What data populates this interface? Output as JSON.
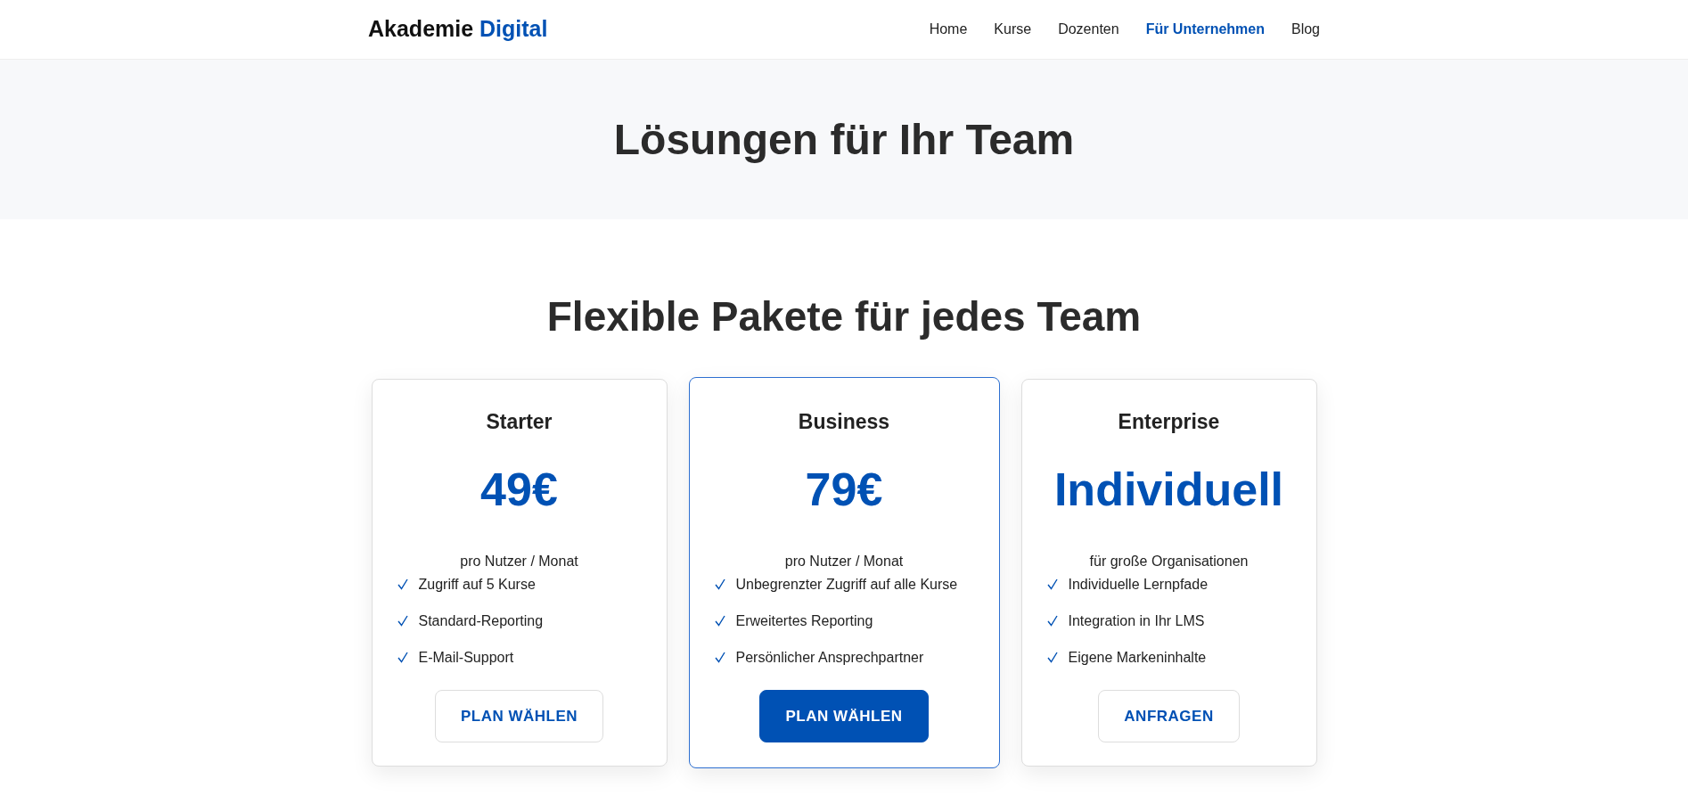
{
  "brand": {
    "name": "Akademie",
    "accent": "Digital"
  },
  "nav": [
    {
      "label": "Home",
      "selected": false
    },
    {
      "label": "Kurse",
      "selected": false
    },
    {
      "label": "Dozenten",
      "selected": false
    },
    {
      "label": "Für Unternehmen",
      "selected": true
    },
    {
      "label": "Blog",
      "selected": false
    }
  ],
  "hero": {
    "title": "Lösungen für Ihr Team"
  },
  "section_title": "Flexible Pakete für jedes Team",
  "plans": [
    {
      "name": "Starter",
      "price": "49€",
      "period": "pro Nutzer / Monat",
      "featured": false,
      "features": [
        "Zugriff auf 5 Kurse",
        "Standard-Reporting",
        "E-Mail-Support"
      ],
      "button": "PLAN WÄHLEN"
    },
    {
      "name": "Business",
      "price": "79€",
      "period": "pro Nutzer / Monat",
      "featured": true,
      "features": [
        "Unbegrenzter Zugriff auf alle Kurse",
        "Erweitertes Reporting",
        "Persönlicher Ansprechpartner"
      ],
      "button": "PLAN WÄHLEN"
    },
    {
      "name": "Enterprise",
      "price": "Individuell",
      "period": "für große Organisationen",
      "featured": false,
      "features": [
        "Individuelle Lernpfade",
        "Integration in Ihr LMS",
        "Eigene Markeninhalte"
      ],
      "button": "ANFRAGEN"
    }
  ]
}
